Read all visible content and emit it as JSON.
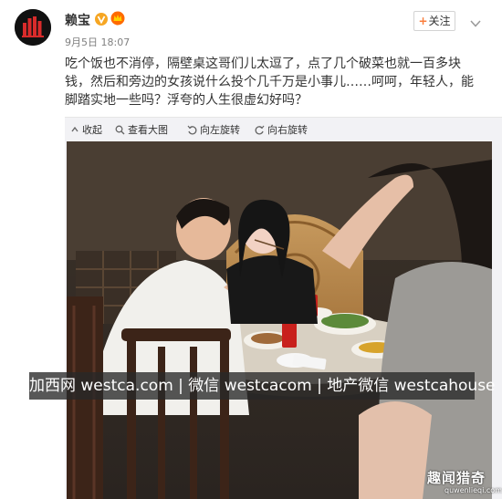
{
  "post": {
    "user_name": "赖宝",
    "verified_icon": "verified-v-icon",
    "vip_icon": "vip-crown-icon",
    "time": "9月5日 18:07",
    "follow_label": "关注",
    "follow_icon": "plus-icon",
    "more_icon": "chevron-down-icon",
    "text": "吃个饭也不消停，隔壁桌这哥们儿太逗了，点了几个破菜也就一百多块钱，然后和旁边的女孩说什么投个几千万是小事儿……呵呵，年轻人，能脚踏实地一些吗？浮夸的人生很虚幻好吗？"
  },
  "toolbar": {
    "collapse_label": "收起",
    "view_label": "查看大图",
    "rotate_left_label": "向左旋转",
    "rotate_right_label": "向右旋转"
  },
  "overlay": {
    "watermark": "加西网 westca.com | 微信 westcacom | 地产微信 westcahouse",
    "corner_logo": "趣闻猎奇",
    "corner_url": "quwenlieqi.com"
  },
  "colors": {
    "accent": "#fa7d3c",
    "verified": "#f6a623",
    "toolbar_bg": "#f2f2f5"
  }
}
